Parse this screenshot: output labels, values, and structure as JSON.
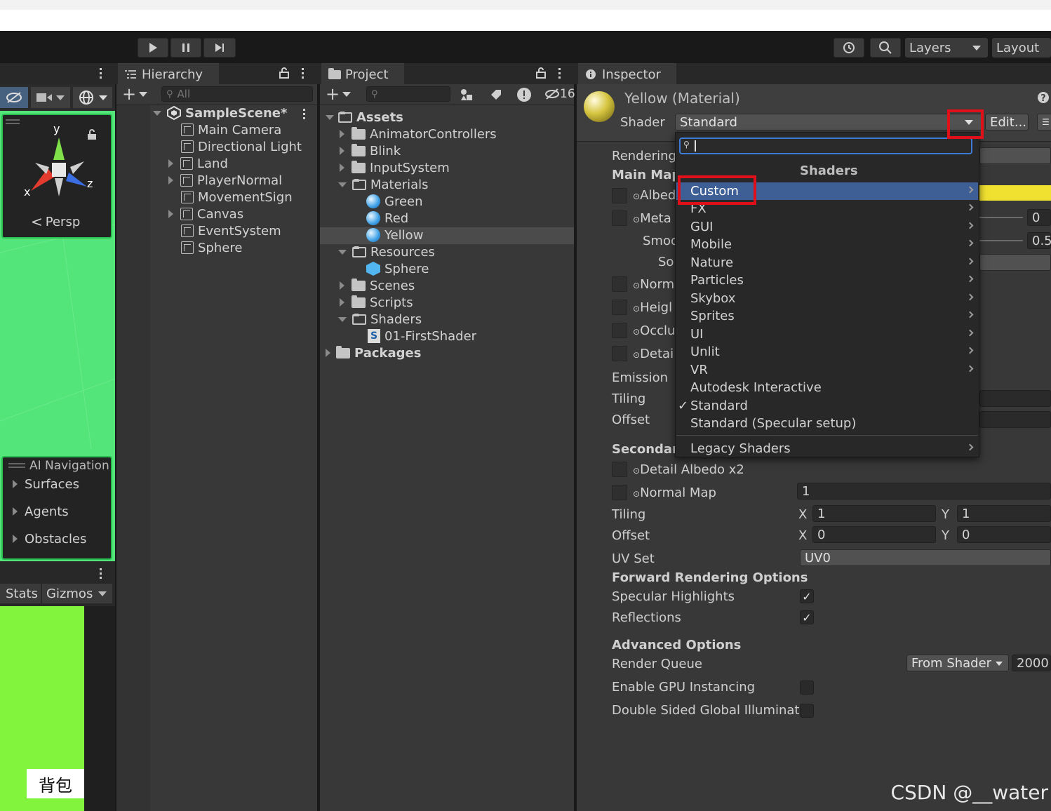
{
  "toolbar": {
    "layers": "Layers",
    "layout": "Layout"
  },
  "scene": {
    "persp": "Persp",
    "axis_y": "y",
    "axis_x": "x",
    "axis_z": "z",
    "ai_nav_title": "AI Navigation",
    "ai_nav_items": [
      "Surfaces",
      "Agents",
      "Obstacles"
    ],
    "stats": "Stats",
    "gizmos": "Gizmos",
    "backpack": "背包"
  },
  "hierarchy": {
    "tab": "Hierarchy",
    "search_placeholder": "All",
    "scene_name": "SampleScene*",
    "items": [
      "Main Camera",
      "Directional Light",
      "Land",
      "PlayerNormal",
      "MovementSign",
      "Canvas",
      "EventSystem",
      "Sphere"
    ]
  },
  "project": {
    "tab": "Project",
    "hidden_count": "16",
    "assets": "Assets",
    "folders": [
      "AnimatorControllers",
      "Blink",
      "InputSystem",
      "Materials"
    ],
    "materials": [
      "Green",
      "Red",
      "Yellow"
    ],
    "resources": "Resources",
    "resources_items": [
      "Sphere"
    ],
    "folders2": [
      "Scenes",
      "Scripts",
      "Shaders"
    ],
    "shader_items": [
      "01-FirstShader"
    ],
    "packages": "Packages"
  },
  "inspector": {
    "tab": "Inspector",
    "title": "Yellow (Material)",
    "shader_label": "Shader",
    "shader_value": "Standard",
    "edit_button": "Edit...",
    "rendering": "Rendering",
    "main_maps": "Main Map",
    "albedo": "Albed",
    "metallic": "Meta",
    "metallic_value": "0",
    "smoothness": "Smoo",
    "smoothness_value": "0.5",
    "source": "So",
    "normal": "Norm",
    "height": "Heigl",
    "occlusion": "Occlu",
    "detail": "Detai",
    "emission": "Emission",
    "tiling": "Tiling",
    "offset": "Offset",
    "secondary": "Secondary",
    "detail_albedo": "Detail Albedo x2",
    "normal_map": "Normal Map",
    "normal_map_value": "1",
    "tiling2": "Tiling",
    "offset2": "Offset",
    "x_label": "X",
    "y_label": "Y",
    "tiling_x": "1",
    "tiling_y": "1",
    "offset_x": "0",
    "offset_y": "0",
    "uv_set": "UV Set",
    "uv_value": "UV0",
    "forward_title": "Forward Rendering Options",
    "specular": "Specular Highlights",
    "reflections": "Reflections",
    "advanced_title": "Advanced Options",
    "render_queue": "Render Queue",
    "render_queue_mode": "From Shader",
    "render_queue_value": "2000",
    "gpu_instancing": "Enable GPU Instancing",
    "double_sided": "Double Sided Global Illuminati",
    "check": "✓"
  },
  "shader_menu": {
    "header": "Shaders",
    "items": [
      "Custom",
      "FX",
      "GUI",
      "Mobile",
      "Nature",
      "Particles",
      "Skybox",
      "Sprites",
      "UI",
      "Unlit",
      "VR",
      "Autodesk Interactive",
      "Standard",
      "Standard (Specular setup)"
    ],
    "legacy": "Legacy Shaders",
    "checkmark": "✓"
  },
  "colors": {
    "accent_highlight": "#e0101a",
    "selected_row": "#3e5f96",
    "albedo_color": "#f0e030",
    "scene_green": "#53e47a"
  },
  "watermark": "CSDN @__water"
}
